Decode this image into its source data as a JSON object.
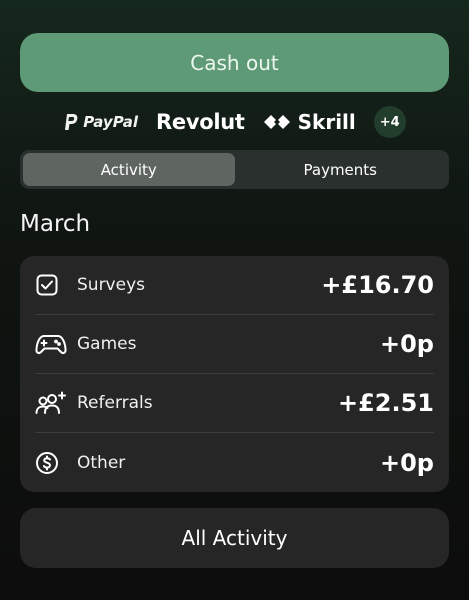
{
  "cashout_label": "Cash out",
  "providers": {
    "paypal": "PayPal",
    "revolut": "Revolut",
    "skrill": "Skrill",
    "more": "+4"
  },
  "tabs": [
    {
      "label": "Activity",
      "active": true
    },
    {
      "label": "Payments",
      "active": false
    }
  ],
  "month": "March",
  "categories": [
    {
      "label": "Surveys",
      "amount": "+£16.70",
      "icon": "checkbox-icon"
    },
    {
      "label": "Games",
      "amount": "+0p",
      "icon": "gamepad-icon"
    },
    {
      "label": "Referrals",
      "amount": "+£2.51",
      "icon": "users-plus-icon"
    },
    {
      "label": "Other",
      "amount": "+0p",
      "icon": "dollar-circle-icon"
    }
  ],
  "all_activity_label": "All Activity",
  "colors": {
    "accent": "#5d9a75",
    "card": "#262626",
    "tab_active": "#5f6662"
  }
}
